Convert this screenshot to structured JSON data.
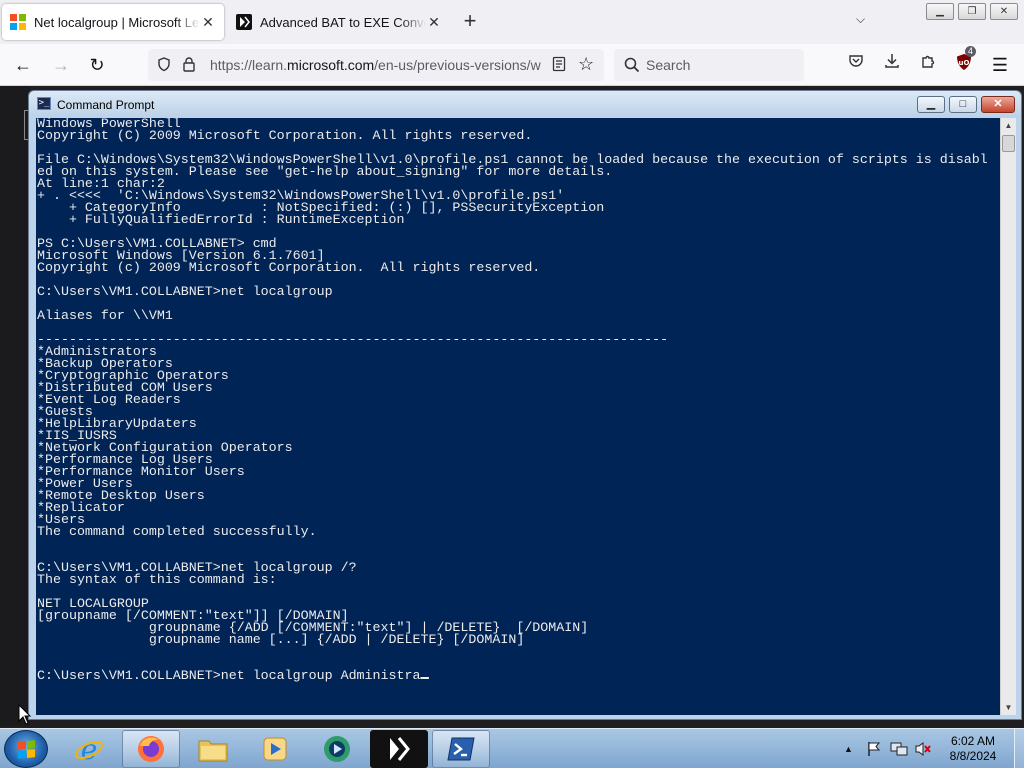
{
  "browser": {
    "tabs": [
      {
        "title": "Net localgroup | Microsoft Lear",
        "active": true
      },
      {
        "title": "Advanced BAT to EXE Converte",
        "active": false
      }
    ],
    "new_tab_label": "+",
    "list_tabs_label": "⌵",
    "window_controls": {
      "minimize": "▁",
      "restore": "❐",
      "close": "✕"
    },
    "url": {
      "prefix": "https://learn.",
      "domain": "microsoft.com",
      "suffix": "/en-us/previous-versions/w"
    },
    "search_placeholder": "Search",
    "extension_badge": "4"
  },
  "cmd_window": {
    "title": "Command Prompt",
    "icon_glyph": ">_",
    "buttons": {
      "minimize": "▁",
      "maximize": "□",
      "close": "✕"
    },
    "lines": [
      "Windows PowerShell",
      "Copyright (C) 2009 Microsoft Corporation. All rights reserved.",
      "",
      "File C:\\Windows\\System32\\WindowsPowerShell\\v1.0\\profile.ps1 cannot be loaded because the execution of scripts is disabl",
      "ed on this system. Please see \"get-help about_signing\" for more details.",
      "At line:1 char:2",
      "+ . <<<<  'C:\\Windows\\System32\\WindowsPowerShell\\v1.0\\profile.ps1'",
      "    + CategoryInfo          : NotSpecified: (:) [], PSSecurityException",
      "    + FullyQualifiedErrorId : RuntimeException",
      "",
      "PS C:\\Users\\VM1.COLLABNET> cmd",
      "Microsoft Windows [Version 6.1.7601]",
      "Copyright (c) 2009 Microsoft Corporation.  All rights reserved.",
      "",
      "C:\\Users\\VM1.COLLABNET>net localgroup",
      "",
      "Aliases for \\\\VM1",
      "",
      "-------------------------------------------------------------------------------",
      "*Administrators",
      "*Backup Operators",
      "*Cryptographic Operators",
      "*Distributed COM Users",
      "*Event Log Readers",
      "*Guests",
      "*HelpLibraryUpdaters",
      "*IIS_IUSRS",
      "*Network Configuration Operators",
      "*Performance Log Users",
      "*Performance Monitor Users",
      "*Power Users",
      "*Remote Desktop Users",
      "*Replicator",
      "*Users",
      "The command completed successfully.",
      "",
      "",
      "C:\\Users\\VM1.COLLABNET>net localgroup /?",
      "The syntax of this command is:",
      "",
      "NET LOCALGROUP",
      "[groupname [/COMMENT:\"text\"]] [/DOMAIN]",
      "              groupname {/ADD [/COMMENT:\"text\"] | /DELETE}  [/DOMAIN]",
      "              groupname name [...] {/ADD | /DELETE} [/DOMAIN]",
      "",
      "",
      "C:\\Users\\VM1.COLLABNET>net localgroup Administra"
    ]
  },
  "taskbar": {
    "apps": [
      {
        "name": "internet-explorer",
        "open": false
      },
      {
        "name": "firefox",
        "open": true
      },
      {
        "name": "file-explorer",
        "open": false
      },
      {
        "name": "media-player",
        "open": false
      },
      {
        "name": "media-center",
        "open": false
      },
      {
        "name": "bat-to-exe-converter",
        "open": false
      },
      {
        "name": "powershell",
        "open": true
      }
    ],
    "tray_arrow": "▲",
    "time": "6:02 AM",
    "date": "8/8/2024"
  },
  "colors": {
    "console_bg": "#012456",
    "console_text": "#ececec",
    "taskbar": "#8fb3d9"
  }
}
